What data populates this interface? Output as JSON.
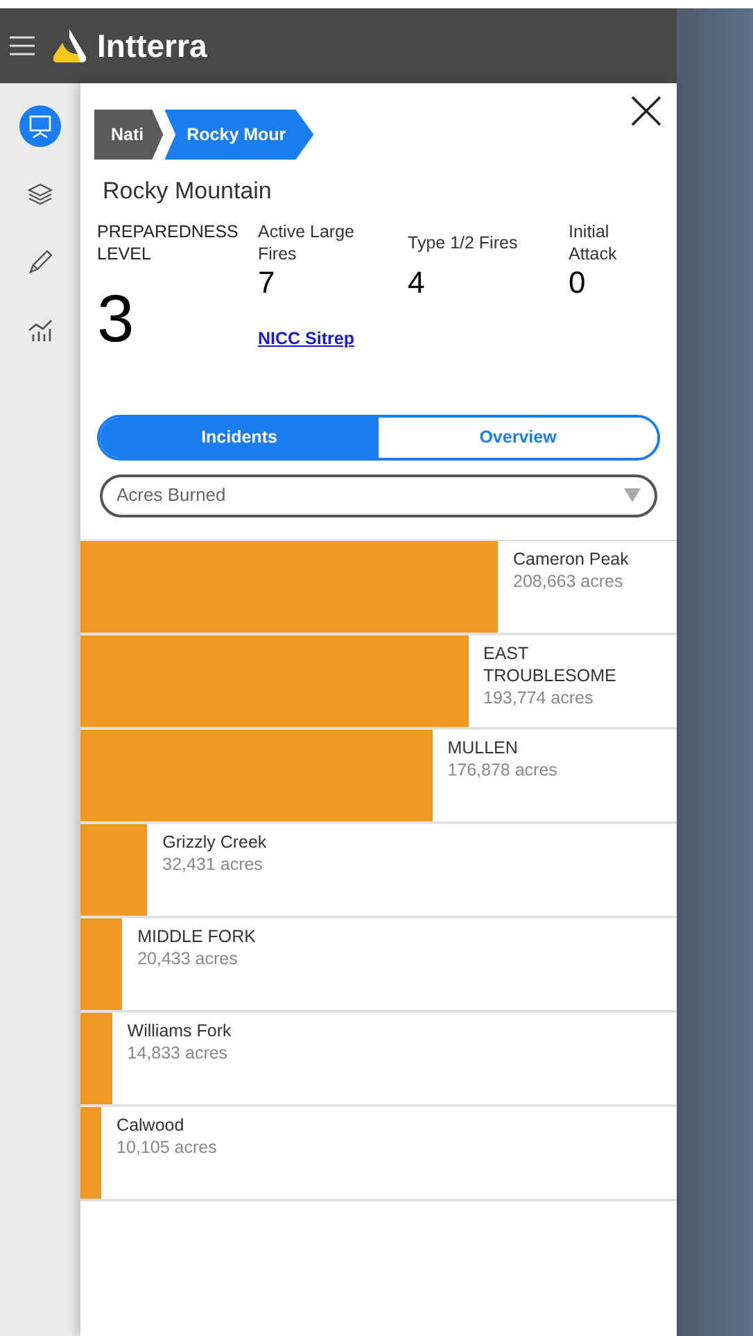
{
  "app": {
    "title": "Intterra"
  },
  "sidebar": {
    "items": [
      {
        "kind": "presentation",
        "selected": true
      },
      {
        "kind": "layers",
        "selected": false
      },
      {
        "kind": "pencil",
        "selected": false
      },
      {
        "kind": "chart",
        "selected": false
      }
    ]
  },
  "breadcrumbs": [
    {
      "label": "Nati",
      "selected": false
    },
    {
      "label": "Rocky Mour",
      "selected": true
    }
  ],
  "region": "Rocky Mountain",
  "preparedness": {
    "label": "PREPAREDNESS LEVEL",
    "value": "3"
  },
  "stats": [
    {
      "label": "Active Large Fires",
      "value": "7"
    },
    {
      "label": "Type 1/2 Fires",
      "value": "4"
    },
    {
      "label": "Initial Attack",
      "value": "0"
    }
  ],
  "link": "NICC Sitrep",
  "tabs": [
    {
      "label": "Incidents",
      "selected": true
    },
    {
      "label": "Overview",
      "selected": false
    }
  ],
  "sort_select": {
    "value": "Acres Burned"
  },
  "incidents": [
    {
      "name": "Cameron Peak",
      "acres": "208,663 acres",
      "level": 0.7
    },
    {
      "name": "EAST TROUBLESOME",
      "acres": "193,774 acres",
      "level": 0.65
    },
    {
      "name": "MULLEN",
      "acres": "176,878 acres",
      "level": 0.59
    },
    {
      "name": "Grizzly Creek",
      "acres": "32,431 acres",
      "level": 0.112
    },
    {
      "name": "MIDDLE FORK",
      "acres": "20,433 acres",
      "level": 0.07
    },
    {
      "name": "Williams Fork",
      "acres": "14,833 acres",
      "level": 0.053
    },
    {
      "name": "Calwood",
      "acres": "10,105 acres",
      "level": 0.035
    }
  ]
}
